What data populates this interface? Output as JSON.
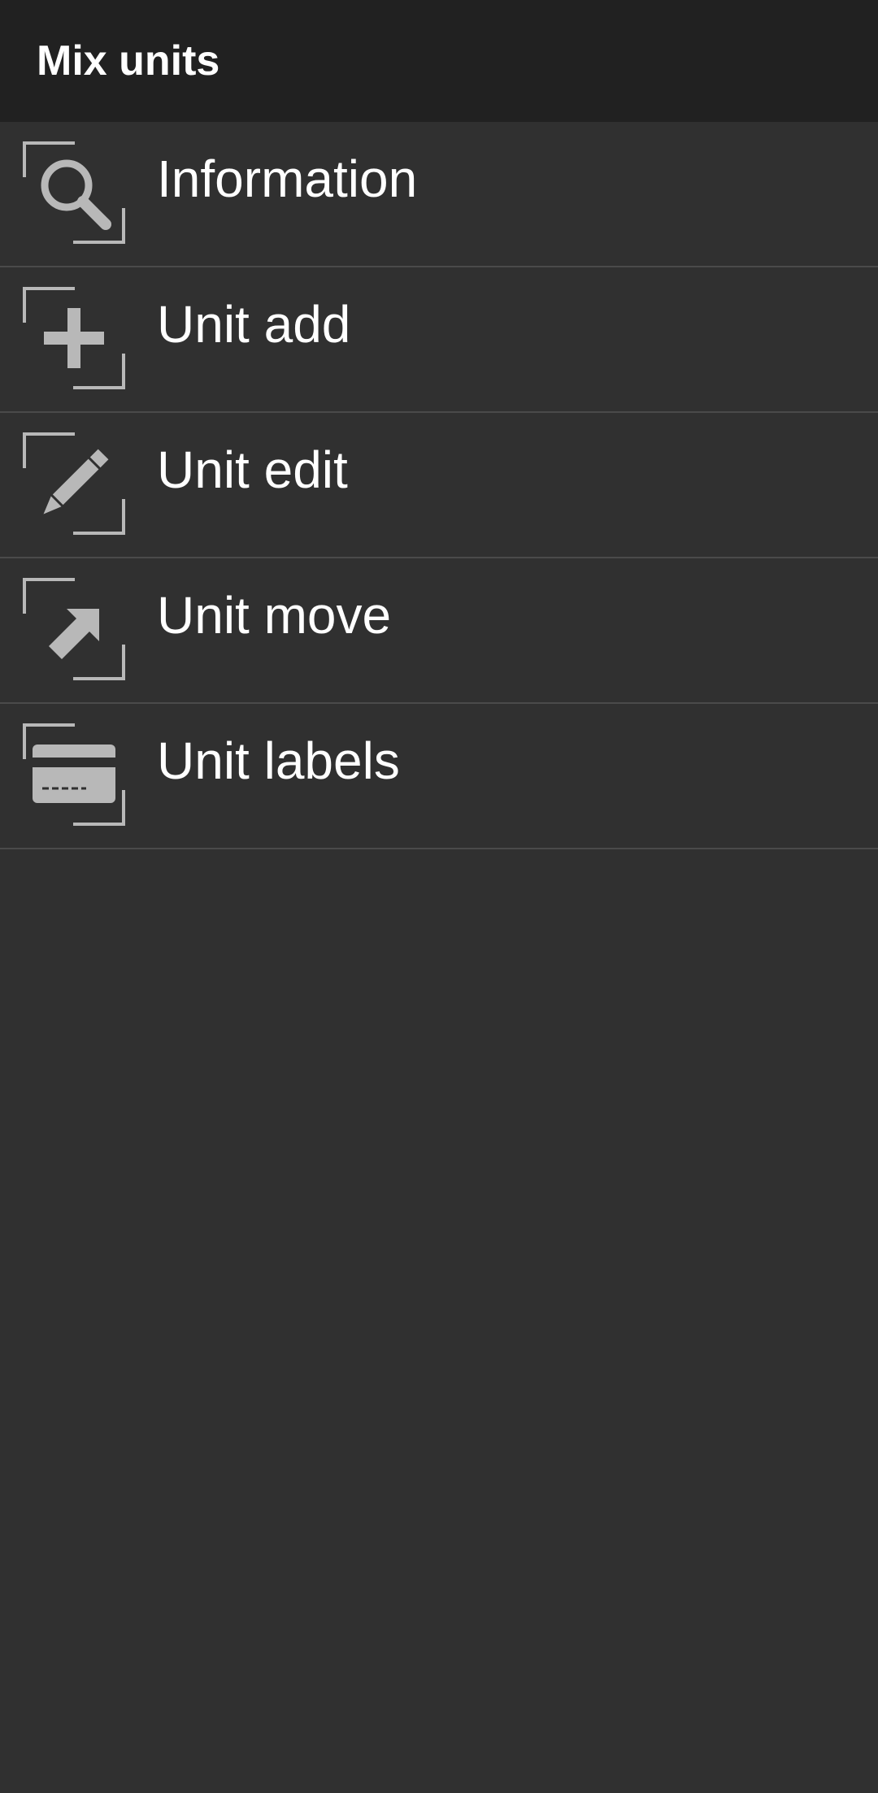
{
  "header": {
    "title": "Mix units"
  },
  "menu": {
    "items": [
      {
        "label": "Information",
        "icon": "magnifier-icon"
      },
      {
        "label": "Unit add",
        "icon": "plus-icon"
      },
      {
        "label": "Unit edit",
        "icon": "pencil-icon"
      },
      {
        "label": "Unit move",
        "icon": "arrow-up-right-icon"
      },
      {
        "label": "Unit labels",
        "icon": "label-card-icon"
      }
    ]
  },
  "colors": {
    "header_bg": "#212121",
    "list_bg": "#303030",
    "divider": "#4a4a4a",
    "icon_gray": "#b8b8b8",
    "text": "#ffffff"
  }
}
